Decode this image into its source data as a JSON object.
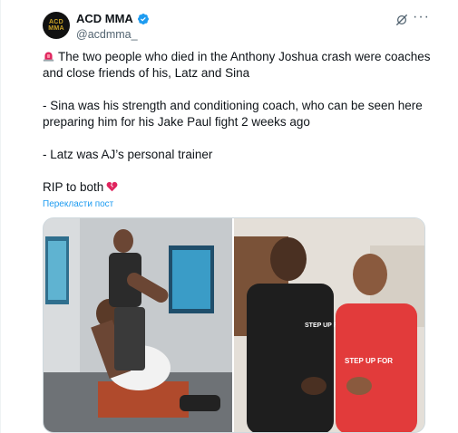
{
  "tweet": {
    "display_name": "ACD MMA",
    "handle": "@acdmma_",
    "avatar_text_top": "ACD",
    "avatar_text_bottom": "MMA",
    "paragraphs": [
      "The two people who died in the Anthony Joshua crash were coaches and close friends of his, Latz and Sina",
      "- Sina was his strength and conditioning coach, who can be seen here preparing him for his Jake Paul fight 2 weeks ago",
      "- Latz was AJ’s personal trainer",
      "RIP to both"
    ],
    "translate_label": "Перекласти пост",
    "more_label": "···",
    "photo_right_shirt_text": "STEP UP FOR SYRIA",
    "photo_right_tee_text": "STEP UP FOR"
  },
  "icons": {
    "verified": "verified-badge-icon",
    "grok": "grok-icon",
    "more": "more-icon",
    "alarm": "rotating-light-icon",
    "heart": "broken-heart-icon"
  },
  "colors": {
    "accent": "#1d9bf0",
    "text": "#0f1419",
    "secondary": "#536471",
    "alarm_red": "#e0245e",
    "heart_red": "#e0245e"
  }
}
